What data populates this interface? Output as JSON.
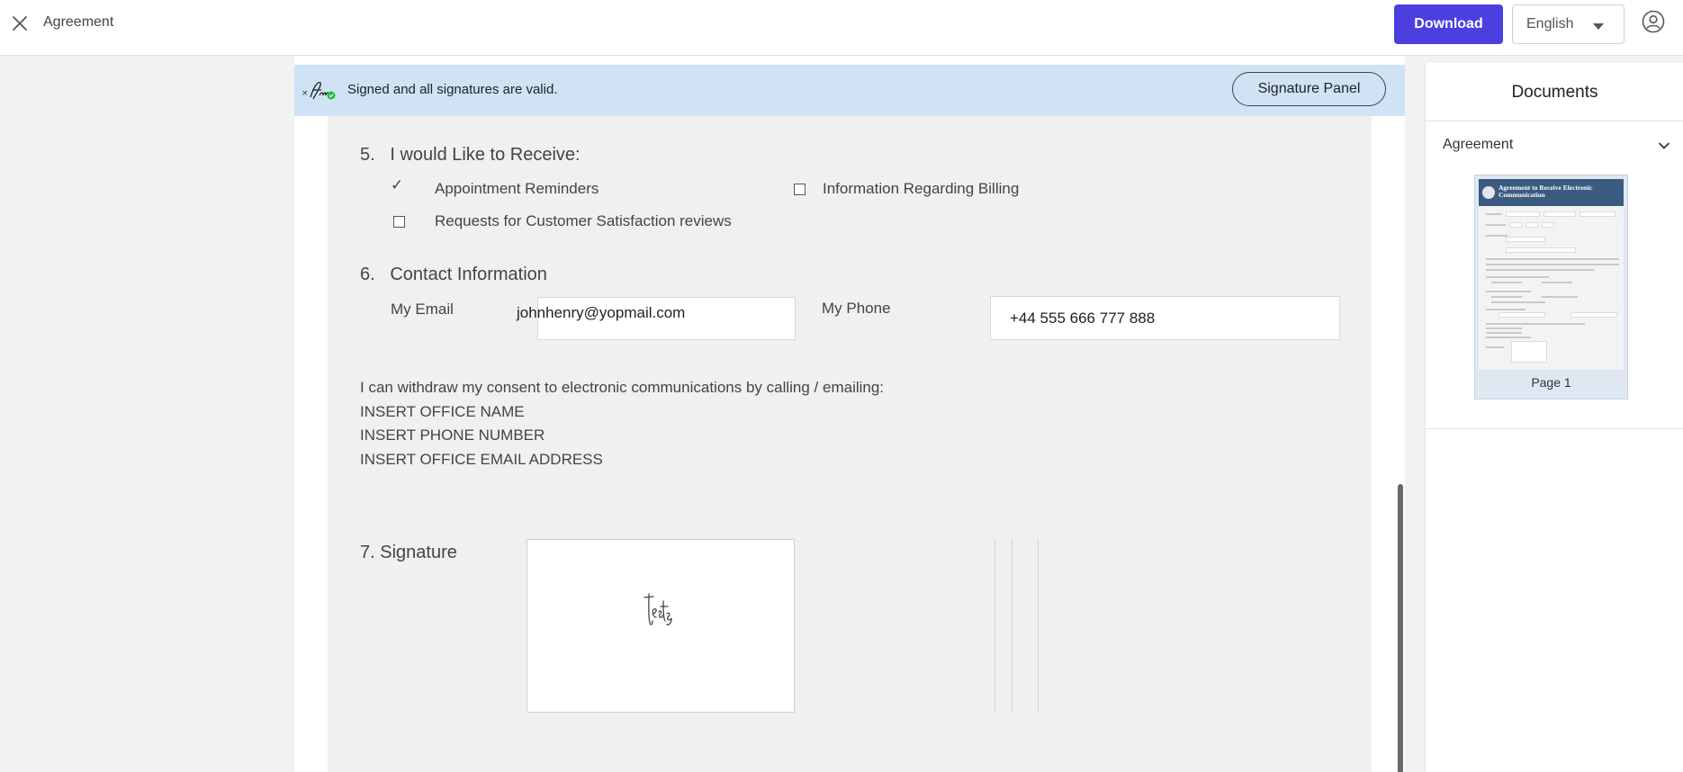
{
  "header": {
    "title": "Agreement",
    "download_label": "Download",
    "language": "English"
  },
  "banner": {
    "status": "Signed and all signatures are valid.",
    "panel_button": "Signature Panel"
  },
  "document": {
    "section5": {
      "heading": "5.   I would Like to Receive:",
      "options": [
        {
          "label": "Appointment Reminders",
          "checked": true
        },
        {
          "label": "Information Regarding Billing",
          "checked": false
        },
        {
          "label": "Requests for Customer Satisfaction reviews",
          "checked": false
        }
      ],
      "check_glyph": "✓"
    },
    "section6": {
      "heading": "6.   Contact Information",
      "email_label": "My Email",
      "email_value": "johnhenry@yopmail.com",
      "phone_label": "My Phone",
      "phone_value": "+44 555 666 777 888"
    },
    "withdraw": {
      "line1": "I can withdraw my consent to electronic communications by calling / emailing:",
      "line2": "INSERT OFFICE NAME",
      "line3": "INSERT PHONE NUMBER",
      "line4": "INSERT OFFICE EMAIL ADDRESS"
    },
    "section7": {
      "heading": "7. Signature",
      "signature_text": "tests"
    }
  },
  "right_panel": {
    "title": "Documents",
    "section_label": "Agreement",
    "thumbnail_title": "Agreement to Receive Electronic Communication",
    "thumbnail_caption": "Page 1"
  },
  "colors": {
    "accent": "#4b3fe0",
    "banner": "#cfe3f5",
    "valid_badge": "#1fbf3a"
  },
  "icons": {
    "close": "close-icon",
    "language_caret": "caret-down-icon",
    "user": "user-circle-icon",
    "signature_valid": "signature-valid-icon",
    "chevron": "chevron-down-icon"
  }
}
